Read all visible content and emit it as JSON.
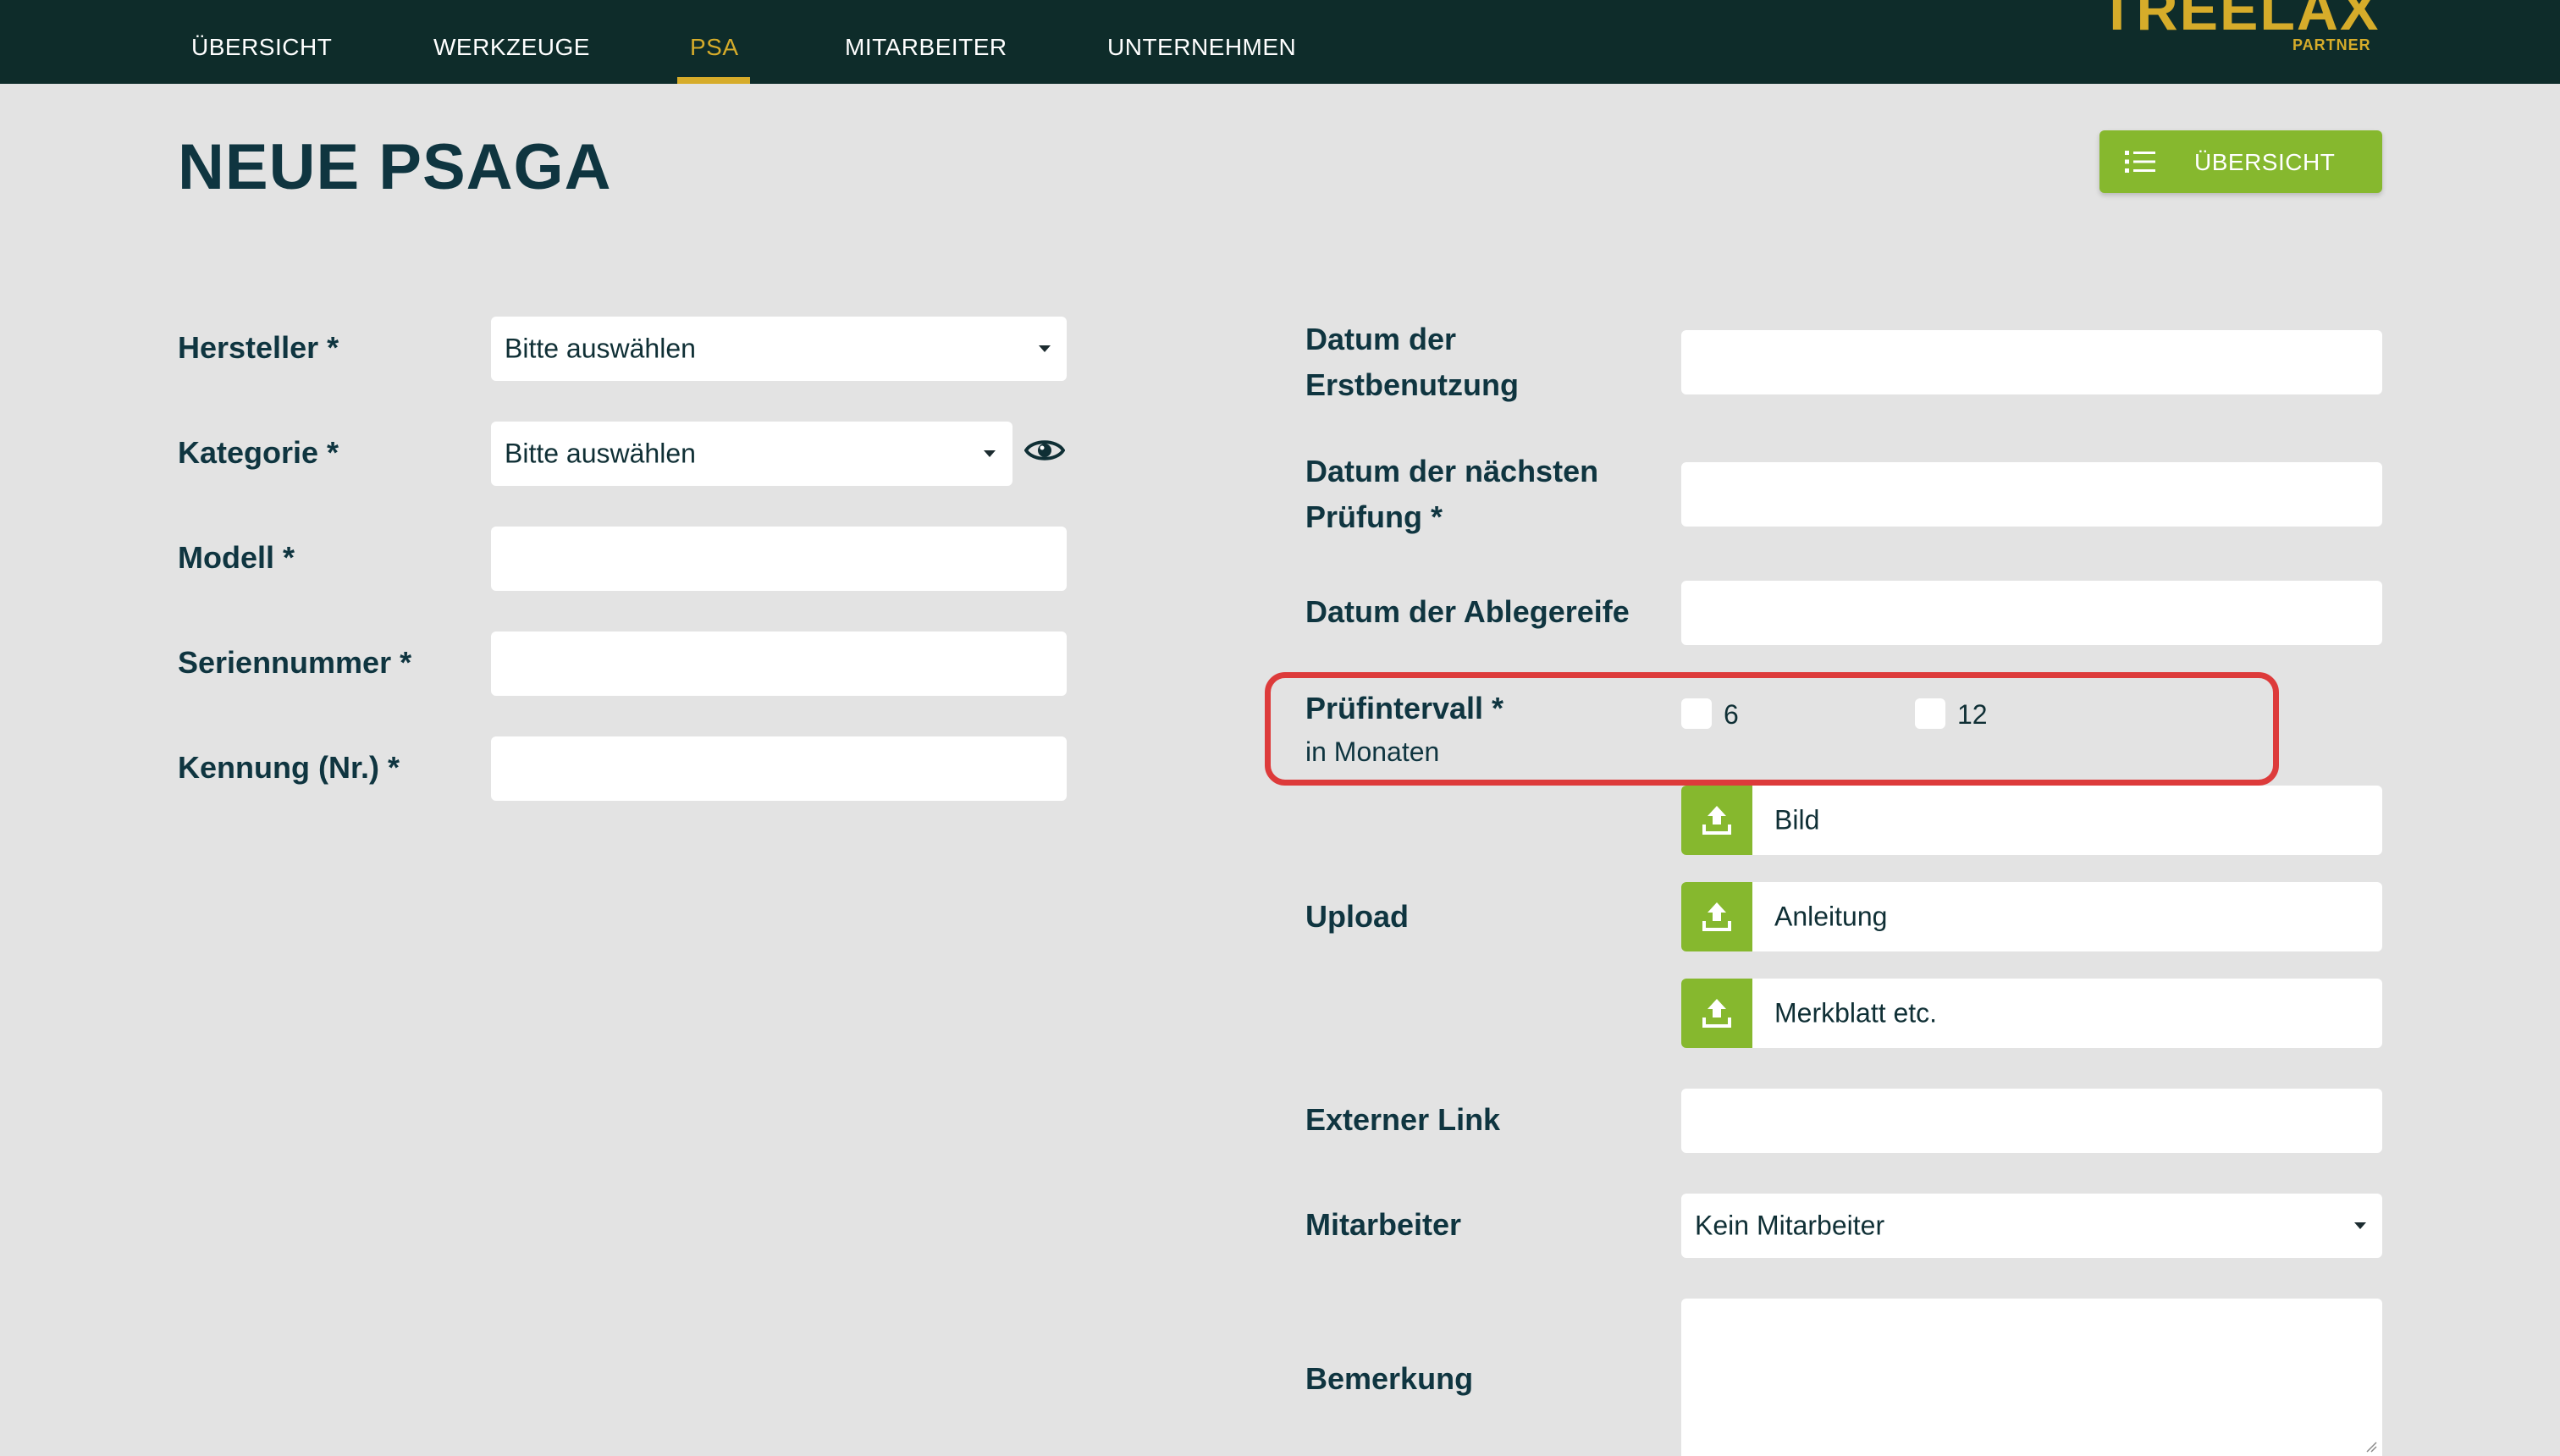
{
  "nav": {
    "items": [
      {
        "label": "ÜBERSICHT"
      },
      {
        "label": "WERKZEUGE"
      },
      {
        "label": "PSA"
      },
      {
        "label": "MITARBEITER"
      },
      {
        "label": "UNTERNEHMEN"
      }
    ],
    "active": "PSA",
    "logo": "TREELAX",
    "logo_sub": "PARTNER"
  },
  "page": {
    "title": "NEUE PSAGA",
    "overview_button": "ÜBERSICHT"
  },
  "form_left": {
    "hersteller": {
      "label": "Hersteller *",
      "value": "Bitte auswählen"
    },
    "kategorie": {
      "label": "Kategorie *",
      "value": "Bitte auswählen"
    },
    "modell": {
      "label": "Modell *",
      "value": ""
    },
    "seriennummer": {
      "label": "Seriennummer *",
      "value": ""
    },
    "kennung": {
      "label": "Kennung (Nr.) *",
      "value": ""
    }
  },
  "form_right": {
    "erstbenutzung": {
      "label_line1": "Datum der",
      "label_line2": "Erstbenutzung",
      "value": ""
    },
    "naechste_pruefung": {
      "label_line1": "Datum der nächsten",
      "label_line2": "Prüfung *",
      "value": ""
    },
    "ablegereife": {
      "label": "Datum der Ablegereife",
      "value": ""
    },
    "pruefintervall": {
      "label": "Prüfintervall *",
      "sublabel": "in Monaten",
      "options": [
        {
          "label": "6",
          "checked": false
        },
        {
          "label": "12",
          "checked": false
        }
      ]
    },
    "upload": {
      "label": "Upload",
      "items": [
        {
          "label": "Bild"
        },
        {
          "label": "Anleitung"
        },
        {
          "label": "Merkblatt etc."
        }
      ]
    },
    "externer_link": {
      "label": "Externer Link",
      "value": ""
    },
    "mitarbeiter": {
      "label": "Mitarbeiter",
      "value": "Kein Mitarbeiter"
    },
    "bemerkung": {
      "label": "Bemerkung",
      "value": ""
    }
  },
  "colors": {
    "nav_bg": "#0e2c2a",
    "accent": "#d6ac2a",
    "button_green": "#86b82e",
    "highlight_red": "#dd3b3b",
    "page_bg": "#e3e3e3"
  }
}
